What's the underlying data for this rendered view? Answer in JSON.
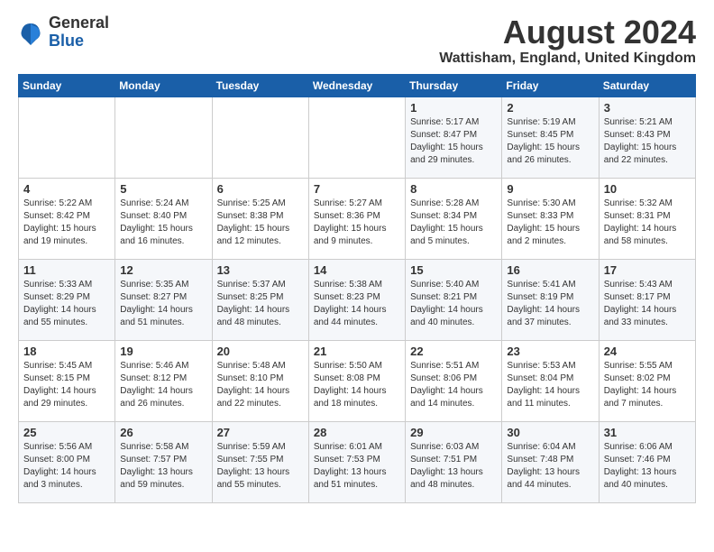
{
  "header": {
    "logo_general": "General",
    "logo_blue": "Blue",
    "month_year": "August 2024",
    "location": "Wattisham, England, United Kingdom"
  },
  "weekdays": [
    "Sunday",
    "Monday",
    "Tuesday",
    "Wednesday",
    "Thursday",
    "Friday",
    "Saturday"
  ],
  "weeks": [
    [
      {
        "day": "",
        "info": ""
      },
      {
        "day": "",
        "info": ""
      },
      {
        "day": "",
        "info": ""
      },
      {
        "day": "",
        "info": ""
      },
      {
        "day": "1",
        "info": "Sunrise: 5:17 AM\nSunset: 8:47 PM\nDaylight: 15 hours\nand 29 minutes."
      },
      {
        "day": "2",
        "info": "Sunrise: 5:19 AM\nSunset: 8:45 PM\nDaylight: 15 hours\nand 26 minutes."
      },
      {
        "day": "3",
        "info": "Sunrise: 5:21 AM\nSunset: 8:43 PM\nDaylight: 15 hours\nand 22 minutes."
      }
    ],
    [
      {
        "day": "4",
        "info": "Sunrise: 5:22 AM\nSunset: 8:42 PM\nDaylight: 15 hours\nand 19 minutes."
      },
      {
        "day": "5",
        "info": "Sunrise: 5:24 AM\nSunset: 8:40 PM\nDaylight: 15 hours\nand 16 minutes."
      },
      {
        "day": "6",
        "info": "Sunrise: 5:25 AM\nSunset: 8:38 PM\nDaylight: 15 hours\nand 12 minutes."
      },
      {
        "day": "7",
        "info": "Sunrise: 5:27 AM\nSunset: 8:36 PM\nDaylight: 15 hours\nand 9 minutes."
      },
      {
        "day": "8",
        "info": "Sunrise: 5:28 AM\nSunset: 8:34 PM\nDaylight: 15 hours\nand 5 minutes."
      },
      {
        "day": "9",
        "info": "Sunrise: 5:30 AM\nSunset: 8:33 PM\nDaylight: 15 hours\nand 2 minutes."
      },
      {
        "day": "10",
        "info": "Sunrise: 5:32 AM\nSunset: 8:31 PM\nDaylight: 14 hours\nand 58 minutes."
      }
    ],
    [
      {
        "day": "11",
        "info": "Sunrise: 5:33 AM\nSunset: 8:29 PM\nDaylight: 14 hours\nand 55 minutes."
      },
      {
        "day": "12",
        "info": "Sunrise: 5:35 AM\nSunset: 8:27 PM\nDaylight: 14 hours\nand 51 minutes."
      },
      {
        "day": "13",
        "info": "Sunrise: 5:37 AM\nSunset: 8:25 PM\nDaylight: 14 hours\nand 48 minutes."
      },
      {
        "day": "14",
        "info": "Sunrise: 5:38 AM\nSunset: 8:23 PM\nDaylight: 14 hours\nand 44 minutes."
      },
      {
        "day": "15",
        "info": "Sunrise: 5:40 AM\nSunset: 8:21 PM\nDaylight: 14 hours\nand 40 minutes."
      },
      {
        "day": "16",
        "info": "Sunrise: 5:41 AM\nSunset: 8:19 PM\nDaylight: 14 hours\nand 37 minutes."
      },
      {
        "day": "17",
        "info": "Sunrise: 5:43 AM\nSunset: 8:17 PM\nDaylight: 14 hours\nand 33 minutes."
      }
    ],
    [
      {
        "day": "18",
        "info": "Sunrise: 5:45 AM\nSunset: 8:15 PM\nDaylight: 14 hours\nand 29 minutes."
      },
      {
        "day": "19",
        "info": "Sunrise: 5:46 AM\nSunset: 8:12 PM\nDaylight: 14 hours\nand 26 minutes."
      },
      {
        "day": "20",
        "info": "Sunrise: 5:48 AM\nSunset: 8:10 PM\nDaylight: 14 hours\nand 22 minutes."
      },
      {
        "day": "21",
        "info": "Sunrise: 5:50 AM\nSunset: 8:08 PM\nDaylight: 14 hours\nand 18 minutes."
      },
      {
        "day": "22",
        "info": "Sunrise: 5:51 AM\nSunset: 8:06 PM\nDaylight: 14 hours\nand 14 minutes."
      },
      {
        "day": "23",
        "info": "Sunrise: 5:53 AM\nSunset: 8:04 PM\nDaylight: 14 hours\nand 11 minutes."
      },
      {
        "day": "24",
        "info": "Sunrise: 5:55 AM\nSunset: 8:02 PM\nDaylight: 14 hours\nand 7 minutes."
      }
    ],
    [
      {
        "day": "25",
        "info": "Sunrise: 5:56 AM\nSunset: 8:00 PM\nDaylight: 14 hours\nand 3 minutes."
      },
      {
        "day": "26",
        "info": "Sunrise: 5:58 AM\nSunset: 7:57 PM\nDaylight: 13 hours\nand 59 minutes."
      },
      {
        "day": "27",
        "info": "Sunrise: 5:59 AM\nSunset: 7:55 PM\nDaylight: 13 hours\nand 55 minutes."
      },
      {
        "day": "28",
        "info": "Sunrise: 6:01 AM\nSunset: 7:53 PM\nDaylight: 13 hours\nand 51 minutes."
      },
      {
        "day": "29",
        "info": "Sunrise: 6:03 AM\nSunset: 7:51 PM\nDaylight: 13 hours\nand 48 minutes."
      },
      {
        "day": "30",
        "info": "Sunrise: 6:04 AM\nSunset: 7:48 PM\nDaylight: 13 hours\nand 44 minutes."
      },
      {
        "day": "31",
        "info": "Sunrise: 6:06 AM\nSunset: 7:46 PM\nDaylight: 13 hours\nand 40 minutes."
      }
    ]
  ]
}
